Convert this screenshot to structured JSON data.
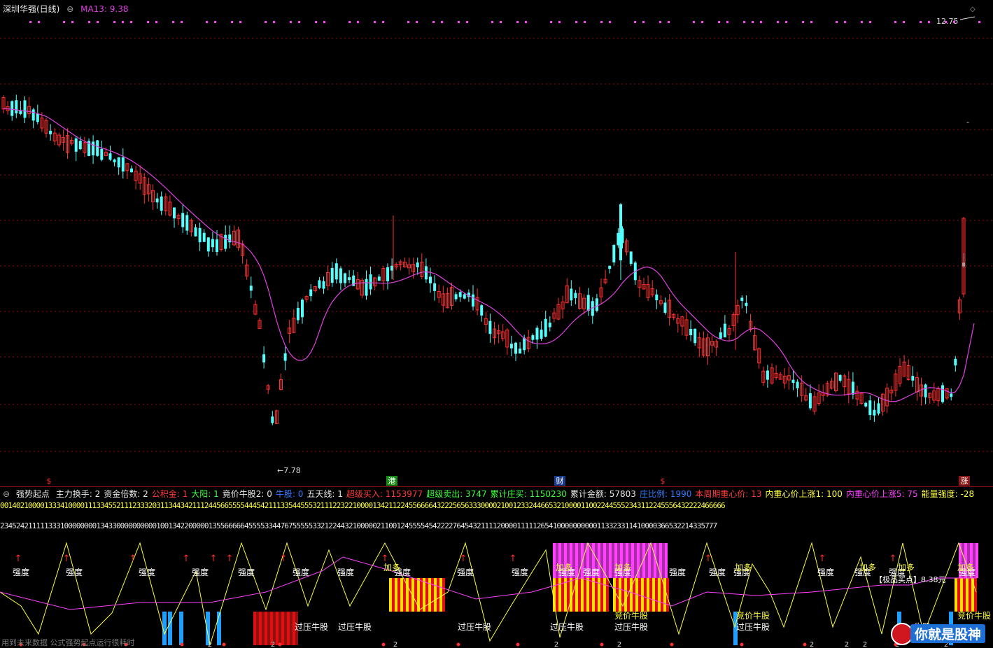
{
  "window": {
    "title": "深圳华强(日线)",
    "ma_label": "MA13: 9.38",
    "price_high": "12.75",
    "price_low": "7.78"
  },
  "main_markers": [
    {
      "text": "$",
      "color": "#ff3030"
    },
    {
      "text": "港",
      "color": "#ffffff",
      "bg": "#1a8a1a"
    },
    {
      "text": "财",
      "color": "#ffffff",
      "bg": "#1a3a8a"
    },
    {
      "text": "$",
      "color": "#ff3030"
    },
    {
      "text": "涨",
      "color": "#ffffff",
      "bg": "#8a1a1a"
    }
  ],
  "indicator": {
    "title": "强势起点",
    "fields": [
      {
        "text": "主力换手: 2",
        "color": "#e8e8e8"
      },
      {
        "text": "资金倍数: 2",
        "color": "#e8e8e8"
      },
      {
        "text": "公积金: 1",
        "color": "#ff3b3b"
      },
      {
        "text": "大阳: 1",
        "color": "#3cff3c"
      },
      {
        "text": "竟价牛股2: 0",
        "color": "#e8e8e8"
      },
      {
        "text": "牛股: 0",
        "color": "#2f7bff"
      },
      {
        "text": "五天线: 1",
        "color": "#e8e8e8"
      },
      {
        "text": "超级买入: 1153977",
        "color": "#ff3b3b"
      },
      {
        "text": "超级卖出: 3747",
        "color": "#3cff3c"
      },
      {
        "text": "累计庄买: 1150230",
        "color": "#3cff3c"
      },
      {
        "text": "累计金额: 57803",
        "color": "#e8e8e8"
      },
      {
        "text": "庄比例: 1990",
        "color": "#2f7bff"
      },
      {
        "text": "本周期重心价: 13",
        "color": "#ff3b3b"
      },
      {
        "text": "内重心价上涨1: 100",
        "color": "#ffff40"
      },
      {
        "text": "内重心价上涨5: 75",
        "color": "#ff40ff"
      },
      {
        "text": "能量强度: -28",
        "color": "#ffff40"
      }
    ],
    "digit_row1": "0014021000013334100001113345521112333203113443421112445665555444542111335445553211122322100001342112245566664322256563330000210012332446653210000110022445552343112245556432222466666",
    "digit_row2": "23452421111133310000000013433000000000010013422000001355666664555533447675555533212244321000002110012455554542222764543211112000011111265410000000000113323311410000366532214335777"
  },
  "labels": {
    "strength": "强度",
    "add": "加多",
    "pressure_bull": "过压牛股",
    "auction_bull": "竞价牛股",
    "best_buy": "【极品买点】8.38元",
    "bull": "牛股",
    "num_two": "2"
  },
  "footer": {
    "note": "用到未来数据 公式强势起点运行很耗时",
    "brand": "你就是股神"
  },
  "colors": {
    "up": "#ff3030",
    "down": "#54ffff",
    "ma": "#e040e0",
    "grid": "#8a1010",
    "yellow": "#ffff40",
    "magenta": "#ff40ff"
  }
}
